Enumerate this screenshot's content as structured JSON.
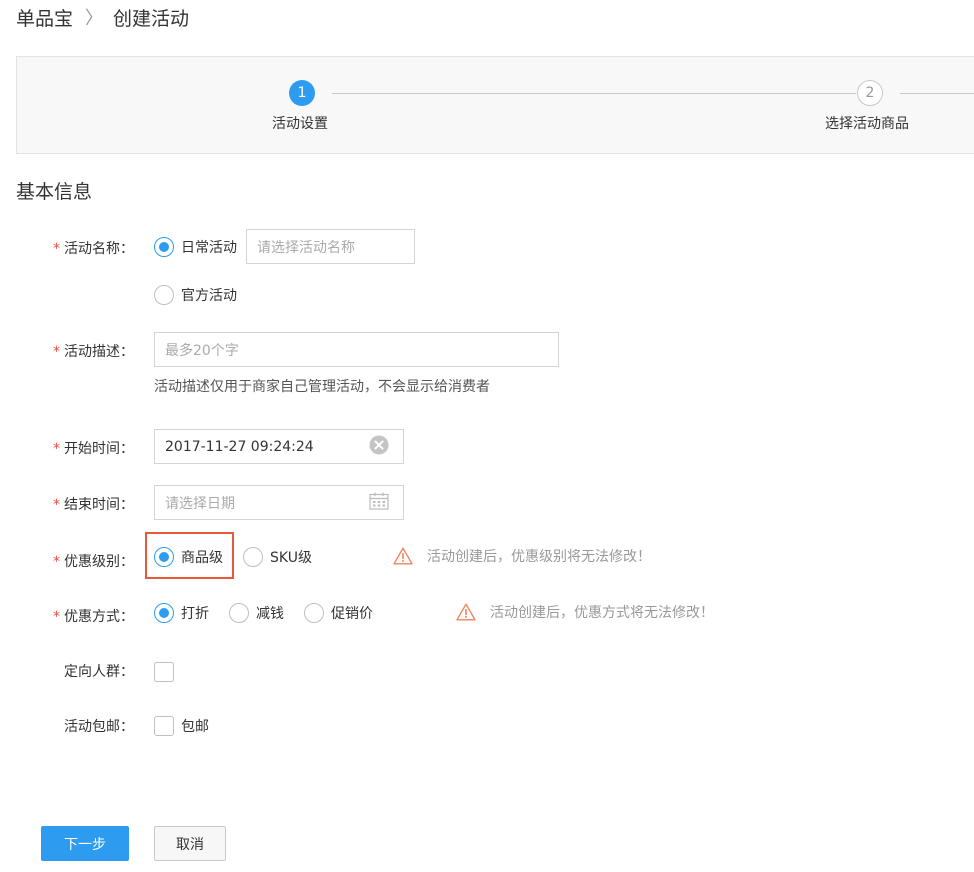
{
  "breadcrumb": {
    "root": "单品宝",
    "separator": "〉",
    "current": "创建活动"
  },
  "steps": [
    {
      "number": "1",
      "label": "活动设置",
      "active": true
    },
    {
      "number": "2",
      "label": "选择活动商品",
      "active": false
    }
  ],
  "section_title": "基本信息",
  "form": {
    "required_mark": "*",
    "activity_name": {
      "label": "活动名称：",
      "options": [
        "日常活动",
        "官方活动"
      ],
      "selected": "日常活动",
      "input_placeholder": "请选择活动名称"
    },
    "activity_desc": {
      "label": "活动描述：",
      "placeholder": "最多20个字",
      "hint": "活动描述仅用于商家自己管理活动，不会显示给消费者"
    },
    "start_time": {
      "label": "开始时间：",
      "value": "2017-11-27 09:24:24"
    },
    "end_time": {
      "label": "结束时间：",
      "placeholder": "请选择日期"
    },
    "discount_level": {
      "label": "优惠级别：",
      "options": [
        "商品级",
        "SKU级"
      ],
      "selected": "商品级",
      "warning": "活动创建后，优惠级别将无法修改！"
    },
    "discount_method": {
      "label": "优惠方式：",
      "options": [
        "打折",
        "减钱",
        "促销价"
      ],
      "selected": "打折",
      "warning": "活动创建后，优惠方式将无法修改！"
    },
    "target_group": {
      "label": "定向人群："
    },
    "free_shipping": {
      "label": "活动包邮：",
      "option": "包邮"
    }
  },
  "buttons": {
    "next": "下一步",
    "cancel": "取消"
  },
  "colors": {
    "primary": "#2d9cf0",
    "required": "#e94a3c",
    "warning_icon": "#f0845c",
    "highlight": "#e8593c"
  }
}
